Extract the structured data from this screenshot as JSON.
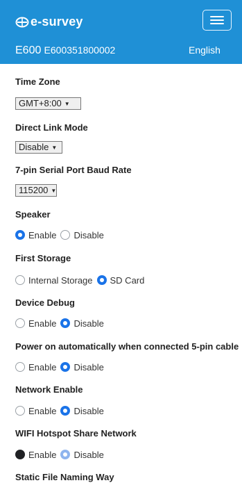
{
  "header": {
    "brand": "e-survey",
    "menu_icon": "hamburger-menu-icon",
    "model": "E600",
    "serial": "E600351800002",
    "language": "English",
    "background": "#1f90d6"
  },
  "settings": {
    "time_zone": {
      "label": "Time Zone",
      "value": "GMT+8:00"
    },
    "direct_link": {
      "label": "Direct Link Mode",
      "value": "Disable"
    },
    "baud_rate": {
      "label": "7-pin Serial Port Baud Rate",
      "value": "115200"
    },
    "speaker": {
      "label": "Speaker",
      "options": [
        "Enable",
        "Disable"
      ],
      "selected": "Enable"
    },
    "first_storage": {
      "label": "First Storage",
      "options": [
        "Internal Storage",
        "SD Card"
      ],
      "selected": "SD Card"
    },
    "device_debug": {
      "label": "Device Debug",
      "options": [
        "Enable",
        "Disable"
      ],
      "selected": "Disable"
    },
    "power_on": {
      "label": "Power on automatically when connected 5-pin cable",
      "options": [
        "Enable",
        "Disable"
      ],
      "selected": "Disable"
    },
    "network_enable": {
      "label": "Network Enable",
      "options": [
        "Enable",
        "Disable"
      ],
      "selected": "Disable"
    },
    "wifi_hotspot": {
      "label": "WIFI Hotspot Share Network",
      "options": [
        "Enable",
        "Disable"
      ],
      "selected": "Enable"
    },
    "static_file_naming": {
      "label": "Static File Naming Way"
    }
  },
  "colors": {
    "accent": "#1a73e8",
    "header": "#1f90d6"
  }
}
